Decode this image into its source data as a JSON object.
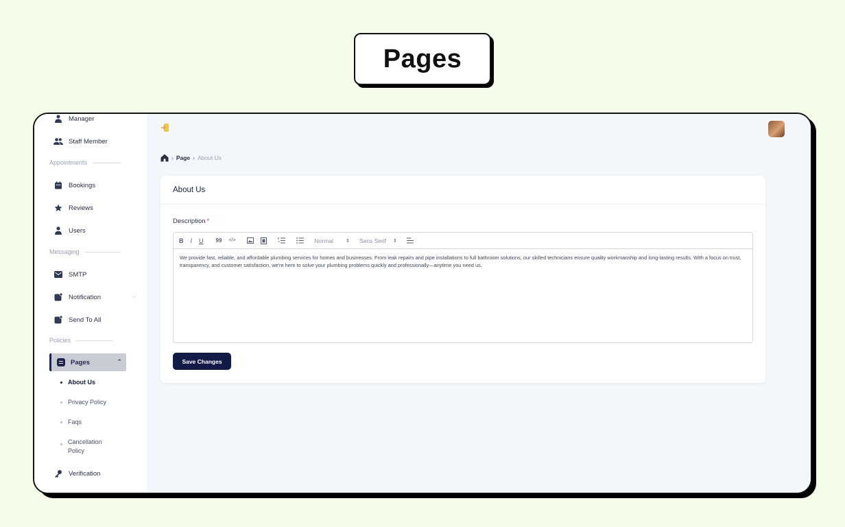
{
  "banner": {
    "title": "Pages"
  },
  "sidebar": {
    "items": [
      {
        "label": "Manager",
        "icon": "manager-icon"
      },
      {
        "label": "Staff Member",
        "icon": "staff-icon"
      },
      {
        "label": "Bookings",
        "icon": "calendar-icon"
      },
      {
        "label": "Reviews",
        "icon": "star-icon"
      },
      {
        "label": "Users",
        "icon": "user-icon"
      },
      {
        "label": "SMTP",
        "icon": "mail-icon"
      },
      {
        "label": "Notification",
        "icon": "notification-icon"
      },
      {
        "label": "Send To All",
        "icon": "send-icon"
      },
      {
        "label": "Verification",
        "icon": "key-icon"
      }
    ],
    "sections": {
      "appointments": "Appointments",
      "messaging": "Messaging",
      "policies": "Policies"
    },
    "pages_label": "Pages",
    "sub_items": [
      "About Us",
      "Privacy Policy",
      "Faqs",
      "Cancellation Policy"
    ]
  },
  "breadcrumb": {
    "page": "Page",
    "current": "About Us"
  },
  "card": {
    "title": "About Us",
    "field_label": "Description",
    "required_mark": "*",
    "toolbar": {
      "bold": "B",
      "italic": "I",
      "underline": "U",
      "quote": "99",
      "code": "</>",
      "header_select": "Normal",
      "font_select": "Sans Serif"
    },
    "content": "We provide fast, reliable, and affordable plumbing services for homes and businesses. From leak repairs and pipe installations to full bathroom solutions, our skilled technicians ensure quality workmanship and long-lasting results. With a focus on trust, transparency, and customer satisfaction, we're here to solve your plumbing problems quickly and professionally—anytime you need us.",
    "save_label": "Save Changes"
  },
  "colors": {
    "accent": "#121a47",
    "background": "#f3fde8",
    "main_bg": "#f3f6fa",
    "required": "#e53e3e"
  }
}
